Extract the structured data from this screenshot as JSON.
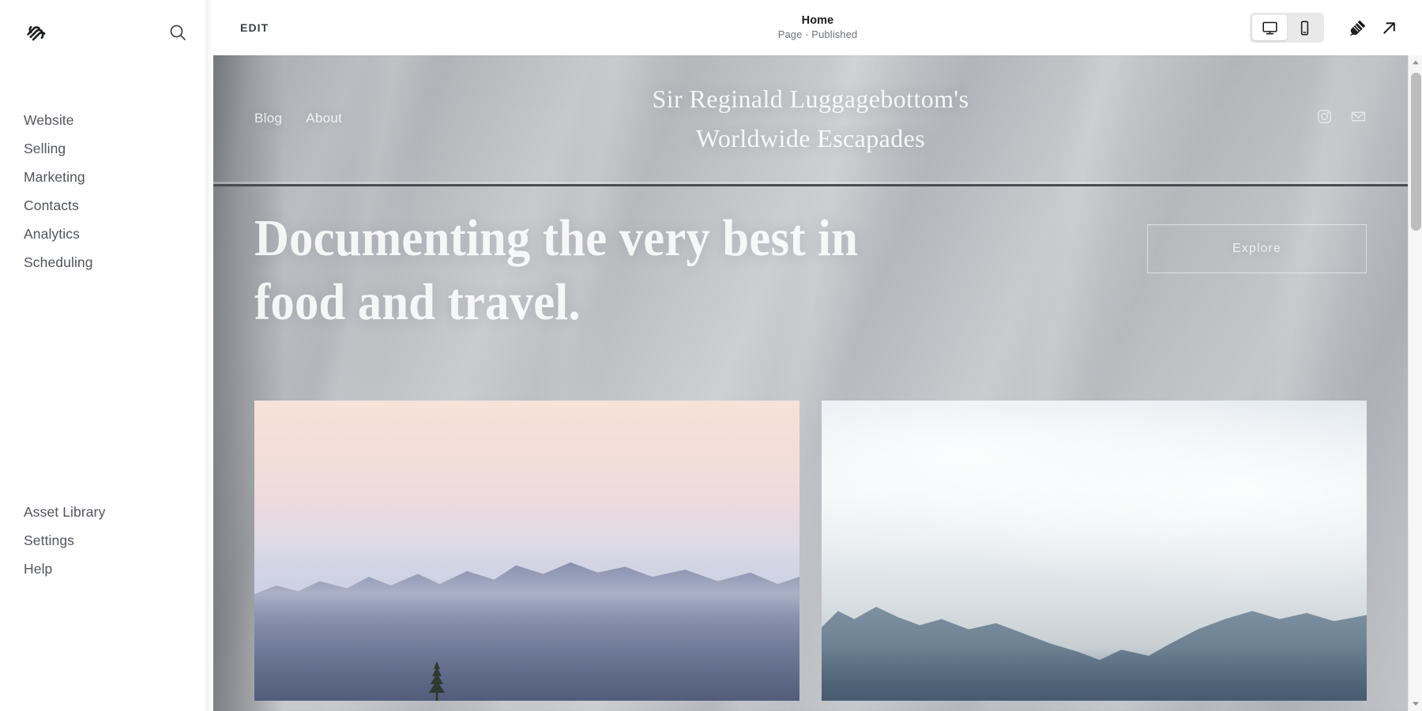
{
  "app": {
    "brand_logo_icon": "squarespace-logo-icon",
    "search_icon": "search-icon"
  },
  "sidebar": {
    "nav_items": [
      {
        "label": "Website",
        "name": "sidebar-item-website"
      },
      {
        "label": "Selling",
        "name": "sidebar-item-selling"
      },
      {
        "label": "Marketing",
        "name": "sidebar-item-marketing"
      },
      {
        "label": "Contacts",
        "name": "sidebar-item-contacts"
      },
      {
        "label": "Analytics",
        "name": "sidebar-item-analytics"
      },
      {
        "label": "Scheduling",
        "name": "sidebar-item-scheduling"
      }
    ],
    "bottom_items": [
      {
        "label": "Asset Library",
        "name": "sidebar-item-asset-library"
      },
      {
        "label": "Settings",
        "name": "sidebar-item-settings"
      },
      {
        "label": "Help",
        "name": "sidebar-item-help"
      }
    ]
  },
  "toolbar": {
    "edit_label": "EDIT",
    "page_title": "Home",
    "page_status": "Page · Published",
    "view_desktop_icon": "desktop-monitor-icon",
    "view_mobile_icon": "mobile-phone-icon",
    "view_selected": "mobile",
    "design_icon": "paintbrush-icon",
    "open_site_icon": "external-link-arrow-icon"
  },
  "site": {
    "nav": [
      {
        "label": "Blog",
        "name": "site-nav-blog"
      },
      {
        "label": "About",
        "name": "site-nav-about"
      }
    ],
    "title_line1": "Sir Reginald Luggagebottom's",
    "title_line2": "Worldwide Escapades",
    "social": [
      {
        "name": "instagram-icon"
      },
      {
        "name": "email-envelope-icon"
      }
    ],
    "headline": "Documenting the very best in food and travel.",
    "cta_label": "Explore",
    "gallery": [
      {
        "name": "gallery-image-sunset-mountains",
        "alt": "Sunset over layered mountain ridges with pink sky"
      },
      {
        "name": "gallery-image-cloudy-mountains",
        "alt": "Overcast sky above blue-grey mountain range"
      }
    ]
  },
  "colors": {
    "sidebar_text": "#51545c",
    "toolbar_title": "#1b1c1e",
    "toolbar_sub": "#6e727a",
    "segment_bg": "#e9e9ea",
    "segment_active_bg": "#ffffff",
    "header_rule": "#4a4c52",
    "scrollbar_thumb": "#bdbdbe"
  },
  "scrollbar": {
    "up_arrow_icon": "scroll-up-arrow-icon",
    "down_arrow_icon": "scroll-down-arrow-icon",
    "thumb_name": "preview-scroll-thumb"
  }
}
